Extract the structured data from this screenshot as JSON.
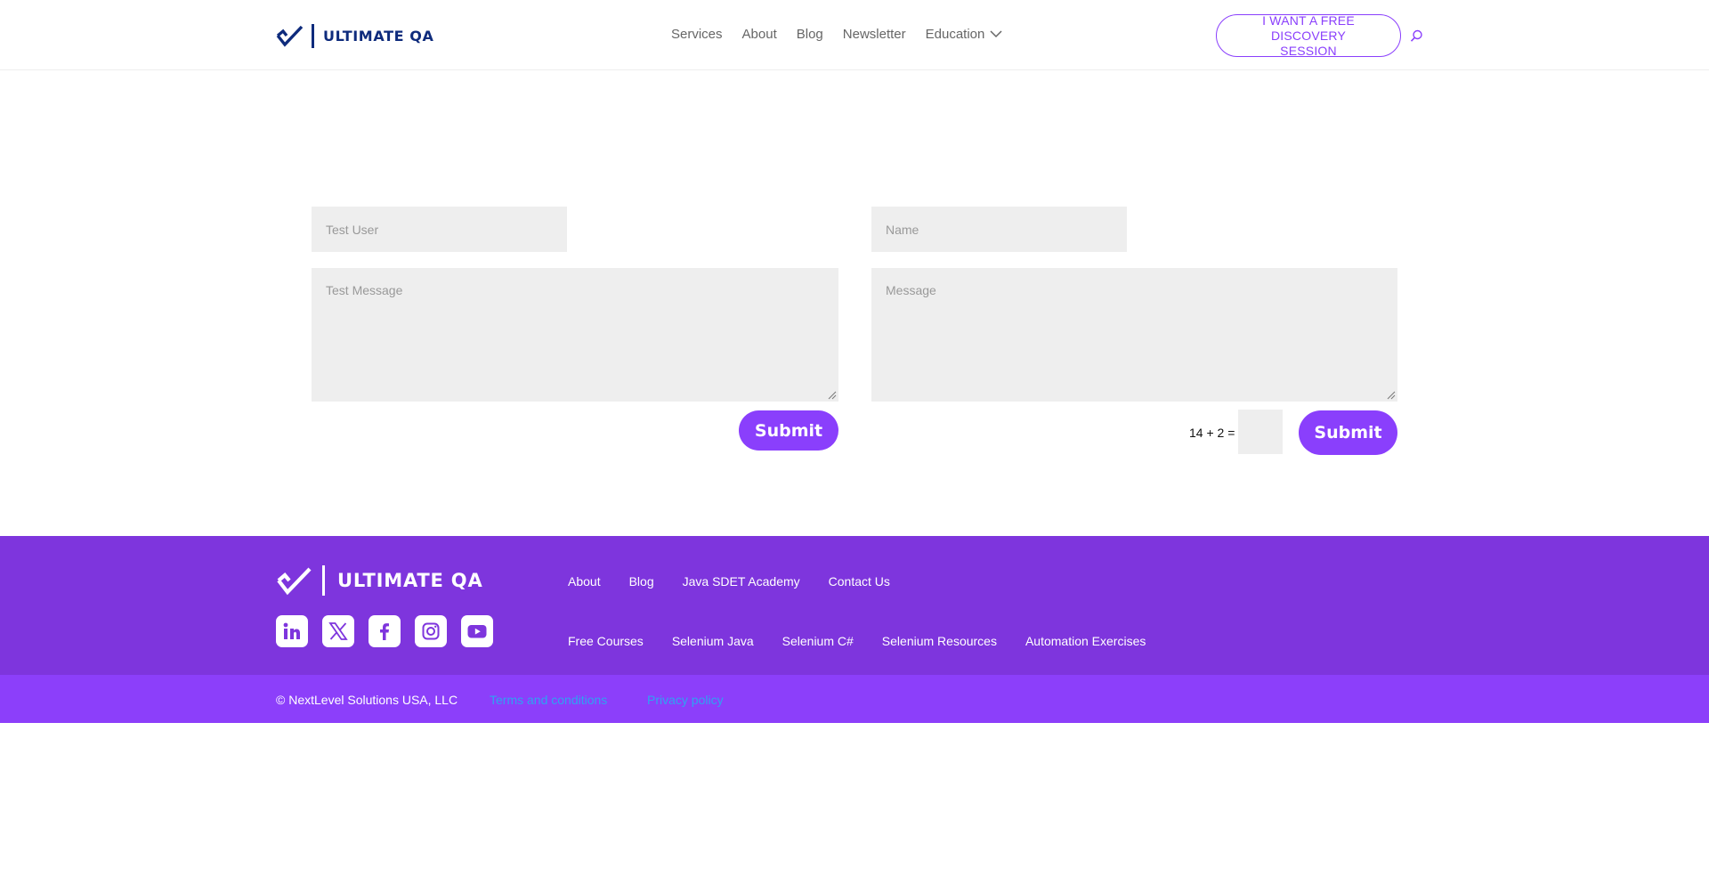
{
  "header": {
    "logo_text": "ULTIMATE QA",
    "nav": [
      "Services",
      "About",
      "Blog",
      "Newsletter",
      "Education"
    ],
    "cta_label": "I WANT A FREE DISCOVERY SESSION"
  },
  "form_left": {
    "name_value": "Test User",
    "message_value": "Test Message",
    "submit_label": "Submit"
  },
  "form_right": {
    "name_placeholder": "Name",
    "message_placeholder": "Message",
    "captcha_question": "14 + 2 =",
    "submit_label": "Submit"
  },
  "footer": {
    "logo_text": "ULTIMATE QA",
    "nav_row1": [
      "About",
      "Blog",
      "Java SDET Academy",
      "Contact Us"
    ],
    "nav_row2": [
      "Free Courses",
      "Selenium Java",
      "Selenium C#",
      "Selenium Resources",
      "Automation Exercises"
    ],
    "socials": [
      "linkedin-icon",
      "x-twitter-icon",
      "facebook-icon",
      "instagram-icon",
      "youtube-icon"
    ],
    "copyright": "© NextLevel Solutions USA, LLC",
    "terms_label": "Terms and conditions",
    "privacy_label": "Privacy policy"
  },
  "colors": {
    "brand_navy": "#0e2b7c",
    "accent_purple": "#8a3ffc",
    "footer_purple": "#7e35dd",
    "footer_bottom_purple": "#8c3ffa",
    "link_blue": "#2ea3f2",
    "field_gray": "#eeeeee"
  }
}
